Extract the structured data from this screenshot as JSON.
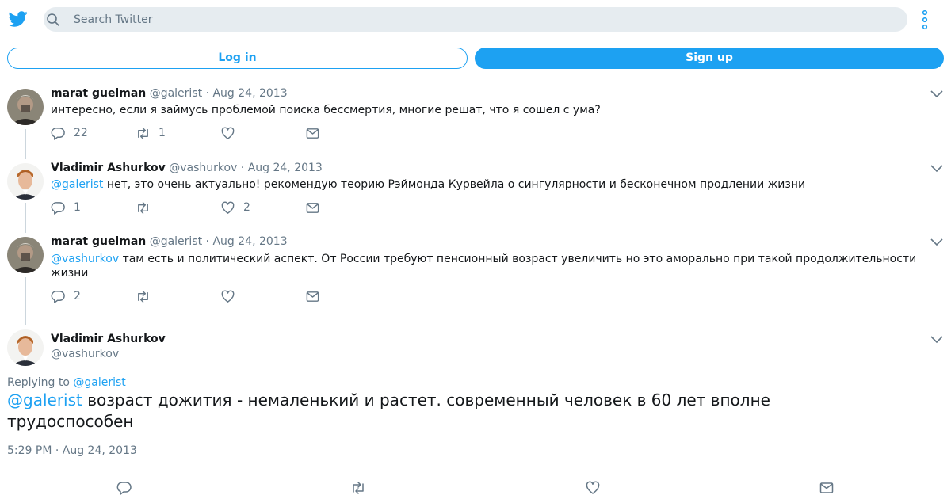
{
  "header": {
    "search_placeholder": "Search Twitter",
    "login_label": "Log in",
    "signup_label": "Sign up"
  },
  "tweets": [
    {
      "name": "marat guelman",
      "handle": "@galerist",
      "sep": " · ",
      "date": "Aug 24, 2013",
      "mention": "",
      "text": "интересно, если я займусь проблемой поиска бессмертия, многие решат, что я сошел с ума?",
      "replies": "22",
      "retweets": "1",
      "likes": ""
    },
    {
      "name": "Vladimir Ashurkov",
      "handle": "@vashurkov",
      "sep": " · ",
      "date": "Aug 24, 2013",
      "mention": "@galerist",
      "text": " нет, это очень актуально! рекомендую теорию Рэймонда Курвейла о сингулярности и бесконечном продлении жизни",
      "replies": "1",
      "retweets": "",
      "likes": "2"
    },
    {
      "name": "marat guelman",
      "handle": "@galerist",
      "sep": " · ",
      "date": "Aug 24, 2013",
      "mention": "@vashurkov",
      "text": " там есть и политический аспект. От России требуют пенсионный возраст увеличить но это аморально при такой продолжительности жизни",
      "replies": "2",
      "retweets": "",
      "likes": ""
    }
  ],
  "main_tweet": {
    "name": "Vladimir Ashurkov",
    "handle": "@vashurkov",
    "replying_prefix": "Replying to ",
    "replying_to": "@galerist",
    "mention": "@galerist",
    "text": " возраст дожития - немаленький и растет. современный человек в 60 лет вполне трудоспособен",
    "timestamp": "5:29 PM · Aug 24, 2013"
  },
  "colors": {
    "accent": "#1da1f2",
    "muted": "#657786",
    "search_bg": "#e6ecf0"
  }
}
